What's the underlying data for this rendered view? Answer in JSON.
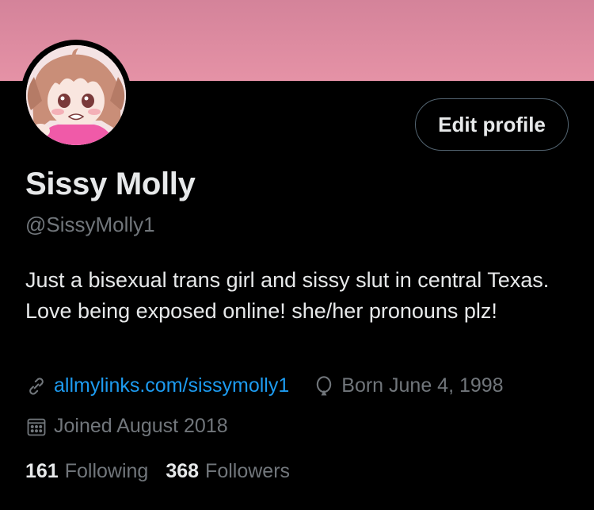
{
  "banner": {
    "color": "#e592a6"
  },
  "avatar": {
    "description": "anime-girl-avatar"
  },
  "profile": {
    "edit_label": "Edit profile",
    "name": "Sissy Molly",
    "handle": "@SissyMolly1",
    "bio": "Just a bisexual trans girl and sissy slut in central Texas. Love being exposed online! she/her pronouns plz!",
    "link": "allmylinks.com/sissymolly1",
    "born": "Born June 4, 1998",
    "joined": "Joined August 2018"
  },
  "stats": {
    "following_count": "161",
    "following_label": "Following",
    "followers_count": "368",
    "followers_label": "Followers"
  },
  "icons": {
    "link": "link-icon",
    "born": "balloon-icon",
    "joined": "calendar-icon"
  },
  "colors": {
    "background": "#000000",
    "text": "#e7e9ea",
    "muted": "#71767b",
    "link": "#1d9bf0",
    "banner": "#e592a6"
  }
}
